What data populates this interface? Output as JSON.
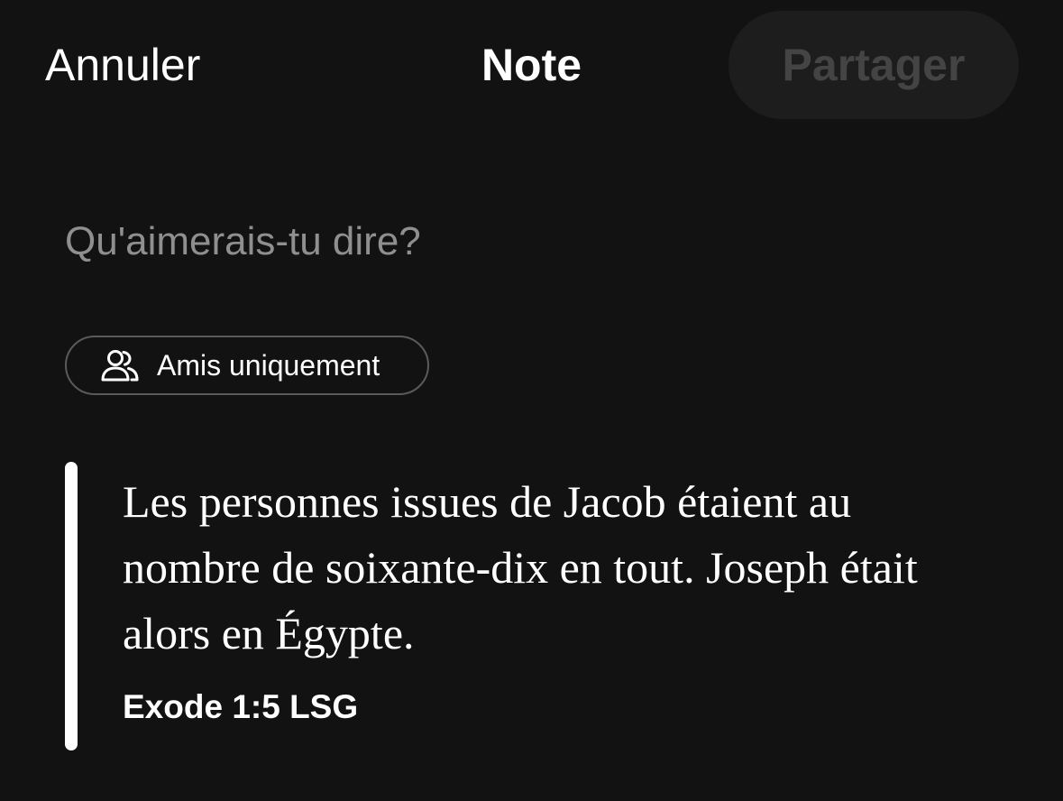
{
  "header": {
    "cancel_label": "Annuler",
    "title": "Note",
    "share_label": "Partager"
  },
  "note": {
    "placeholder": "Qu'aimerais-tu dire?",
    "value": ""
  },
  "audience": {
    "icon": "friends-icon",
    "label": "Amis uniquement"
  },
  "verse": {
    "text": "Les personnes issues de Jacob étaient au nombre de soixante-dix en tout. Joseph était alors en Égypte.",
    "reference": "Exode 1:5 LSG"
  },
  "colors": {
    "background": "#121212",
    "share_button_bg": "#1d1d1d",
    "share_button_text_disabled": "#444444",
    "placeholder": "#8f8f8f",
    "chip_border": "#5a5a5a",
    "text": "#ffffff"
  }
}
